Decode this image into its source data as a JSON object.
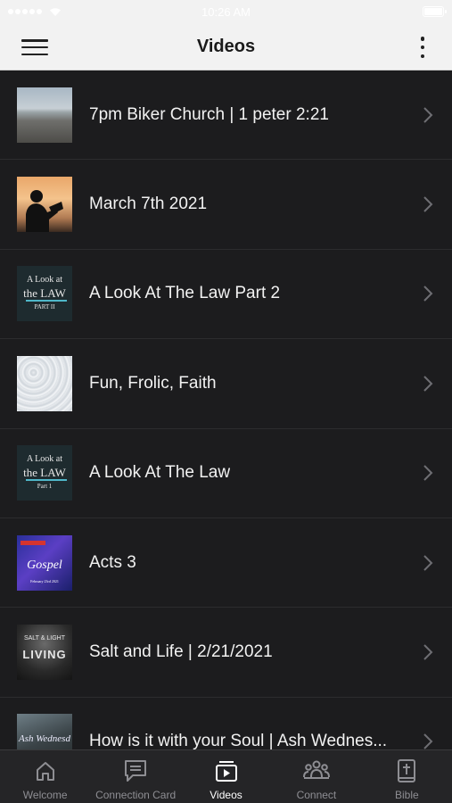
{
  "status_bar": {
    "time": "10:26 AM"
  },
  "nav": {
    "title": "Videos"
  },
  "videos": [
    {
      "title": "7pm Biker Church | 1 peter 2:21"
    },
    {
      "title": "March 7th 2021"
    },
    {
      "title": "A Look At The Law Part 2",
      "thumb_line1": "A Look at",
      "thumb_line2": "the LAW",
      "thumb_line3": "PART II"
    },
    {
      "title": "Fun, Frolic, Faith"
    },
    {
      "title": "A Look At The Law",
      "thumb_line1": "A Look at",
      "thumb_line2": "the LAW",
      "thumb_line3": "Part 1"
    },
    {
      "title": "Acts 3",
      "thumb_line1": "Gospel",
      "thumb_line2": "February 23rd 2021"
    },
    {
      "title": "Salt and Life | 2/21/2021",
      "thumb_line1": "SALT & LIGHT",
      "thumb_line2": "LIVING"
    },
    {
      "title": "How is it with your Soul | Ash Wednes...",
      "thumb_line1": "Ash Wednesd"
    }
  ],
  "tabs": [
    {
      "label": "Welcome",
      "icon": "home-icon"
    },
    {
      "label": "Connection Card",
      "icon": "message-icon"
    },
    {
      "label": "Videos",
      "icon": "video-icon",
      "active": true
    },
    {
      "label": "Connect",
      "icon": "group-icon"
    },
    {
      "label": "Bible",
      "icon": "bible-icon"
    }
  ],
  "colors": {
    "background": "#1c1c1e",
    "header": "#f2f2f2",
    "tab_bar": "#252527",
    "tab_inactive": "#8e8e93",
    "tab_active": "#ffffff"
  }
}
